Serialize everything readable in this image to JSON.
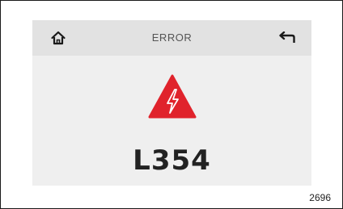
{
  "header": {
    "title": "ERROR",
    "home_icon": "home-icon",
    "back_icon": "back-arrow-icon"
  },
  "alert": {
    "icon": "lightning-warning-icon",
    "icon_color": "#e0232c",
    "code": "L354"
  },
  "figure_number": "2696",
  "colors": {
    "screen_bg": "#efefef",
    "header_bg": "#e2e2e2"
  }
}
